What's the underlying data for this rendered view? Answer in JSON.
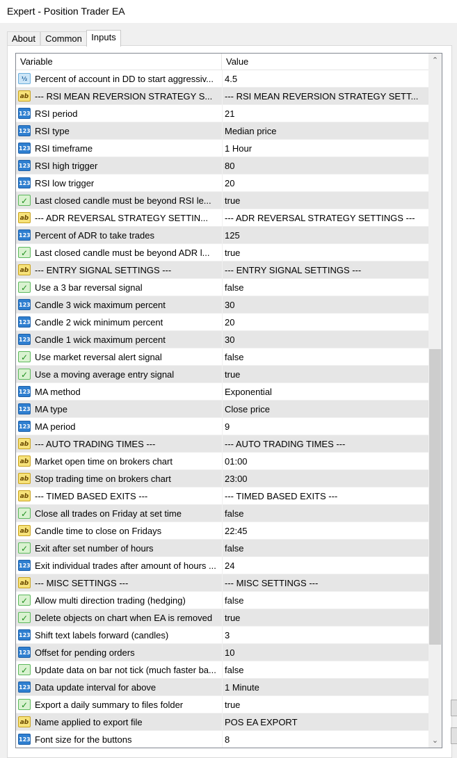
{
  "window": {
    "title": "Expert - Position Trader EA"
  },
  "tabs": [
    {
      "label": "About",
      "active": false
    },
    {
      "label": "Common",
      "active": false
    },
    {
      "label": "Inputs",
      "active": true
    }
  ],
  "table": {
    "columns": {
      "variable": "Variable",
      "value": "Value"
    },
    "icon_labels": {
      "int": "123",
      "str": "ab",
      "bool": "✓",
      "dbl": "½"
    },
    "rows": [
      {
        "type": "dbl",
        "variable": "Percent of account in DD to start aggressiv...",
        "value": "4.5"
      },
      {
        "type": "str",
        "variable": "--- RSI MEAN REVERSION STRATEGY S...",
        "value": "--- RSI MEAN REVERSION STRATEGY SETT..."
      },
      {
        "type": "int",
        "variable": "RSI period",
        "value": "21"
      },
      {
        "type": "int",
        "variable": "RSI type",
        "value": "Median price"
      },
      {
        "type": "int",
        "variable": "RSI timeframe",
        "value": "1 Hour"
      },
      {
        "type": "int",
        "variable": "RSI high trigger",
        "value": "80"
      },
      {
        "type": "int",
        "variable": "RSI low trigger",
        "value": "20"
      },
      {
        "type": "bool",
        "variable": "Last closed candle must be beyond RSI le...",
        "value": "true"
      },
      {
        "type": "str",
        "variable": "--- ADR REVERSAL STRATEGY SETTIN...",
        "value": "--- ADR REVERSAL STRATEGY SETTINGS ---"
      },
      {
        "type": "int",
        "variable": "Percent of ADR to take trades",
        "value": "125"
      },
      {
        "type": "bool",
        "variable": "Last closed candle must be beyond ADR l...",
        "value": "true"
      },
      {
        "type": "str",
        "variable": "--- ENTRY SIGNAL SETTINGS ---",
        "value": "--- ENTRY SIGNAL SETTINGS ---"
      },
      {
        "type": "bool",
        "variable": "Use a 3 bar reversal signal",
        "value": "false"
      },
      {
        "type": "int",
        "variable": "Candle 3 wick maximum percent",
        "value": "30"
      },
      {
        "type": "int",
        "variable": "Candle 2 wick minimum percent",
        "value": "20"
      },
      {
        "type": "int",
        "variable": "Candle 1 wick maximum percent",
        "value": "30"
      },
      {
        "type": "bool",
        "variable": "Use market reversal alert signal",
        "value": "false"
      },
      {
        "type": "bool",
        "variable": "Use a moving average entry signal",
        "value": "true"
      },
      {
        "type": "int",
        "variable": "MA method",
        "value": "Exponential"
      },
      {
        "type": "int",
        "variable": "MA type",
        "value": "Close price"
      },
      {
        "type": "int",
        "variable": "MA period",
        "value": "9"
      },
      {
        "type": "str",
        "variable": "--- AUTO TRADING TIMES ---",
        "value": "--- AUTO TRADING TIMES ---"
      },
      {
        "type": "str",
        "variable": "Market open time on brokers chart",
        "value": "01:00"
      },
      {
        "type": "str",
        "variable": "Stop trading time on brokers chart",
        "value": "23:00"
      },
      {
        "type": "str",
        "variable": "--- TIMED BASED EXITS ---",
        "value": "--- TIMED BASED EXITS ---"
      },
      {
        "type": "bool",
        "variable": "Close all trades on Friday at set time",
        "value": "false"
      },
      {
        "type": "str",
        "variable": "Candle time to close on Fridays",
        "value": "22:45"
      },
      {
        "type": "bool",
        "variable": "Exit after set number of hours",
        "value": "false"
      },
      {
        "type": "int",
        "variable": "Exit individual trades after amount of hours ...",
        "value": "24"
      },
      {
        "type": "str",
        "variable": "--- MISC SETTINGS ---",
        "value": "--- MISC SETTINGS ---"
      },
      {
        "type": "bool",
        "variable": "Allow multi direction trading (hedging)",
        "value": "false"
      },
      {
        "type": "bool",
        "variable": "Delete objects on chart when EA is removed",
        "value": "true"
      },
      {
        "type": "int",
        "variable": "Shift text labels forward (candles)",
        "value": "3"
      },
      {
        "type": "int",
        "variable": "Offset for pending orders",
        "value": "10"
      },
      {
        "type": "bool",
        "variable": "Update data on bar not tick (much faster ba...",
        "value": "false"
      },
      {
        "type": "int",
        "variable": "Data update interval for above",
        "value": "1 Minute"
      },
      {
        "type": "bool",
        "variable": "Export a daily summary to files folder",
        "value": "true"
      },
      {
        "type": "str",
        "variable": "Name applied to export file",
        "value": "POS EA EXPORT"
      },
      {
        "type": "int",
        "variable": "Font size for the buttons",
        "value": "8"
      }
    ]
  },
  "scrollbar": {
    "up_icon": "up-arrow",
    "down_icon": "down-arrow",
    "up_glyph": "⌃",
    "down_glyph": "⌄",
    "position_fraction": 0.5
  }
}
